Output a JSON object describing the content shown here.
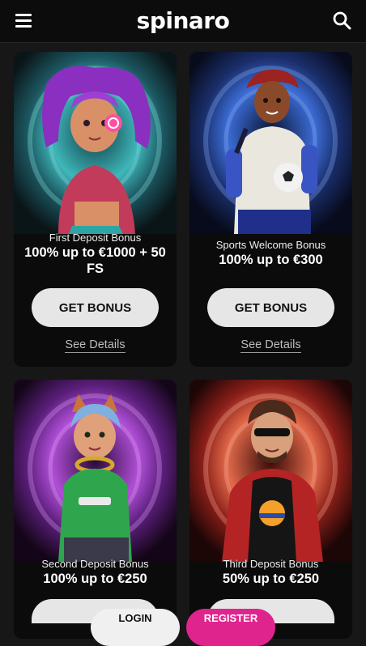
{
  "header": {
    "logo_text": "spinaro",
    "menu_icon": "hamburger-menu-icon",
    "search_icon": "search-icon"
  },
  "colors": {
    "background": "#161716",
    "card": "#0b0b0b",
    "button": "#e6e6e6",
    "register": "#e0248e"
  },
  "cards": [
    {
      "name": "First Deposit Bonus",
      "amount": "100% up to €1000 + 50 FS",
      "button": "GET BONUS",
      "details": "See Details"
    },
    {
      "name": "Sports Welcome Bonus",
      "amount": "100% up to €300",
      "button": "GET BONUS",
      "details": "See Details"
    },
    {
      "name": "Second Deposit Bonus",
      "amount": "100% up to €250"
    },
    {
      "name": "Third Deposit Bonus",
      "amount": "50% up to €250"
    }
  ],
  "footer": {
    "login_label": "LOGIN",
    "register_label": "REGISTER"
  }
}
